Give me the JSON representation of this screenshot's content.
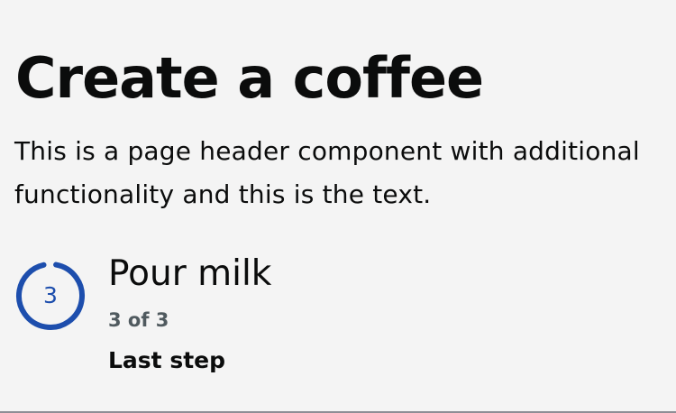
{
  "header": {
    "title": "Create a coffee",
    "description": "This is a page header component with additional functionality and this is the text."
  },
  "step": {
    "number": "3",
    "title": "Pour milk",
    "count_text": "3 of 3",
    "status": "Last step",
    "current": 3,
    "total": 3,
    "progress_color": "#1d4ead"
  }
}
